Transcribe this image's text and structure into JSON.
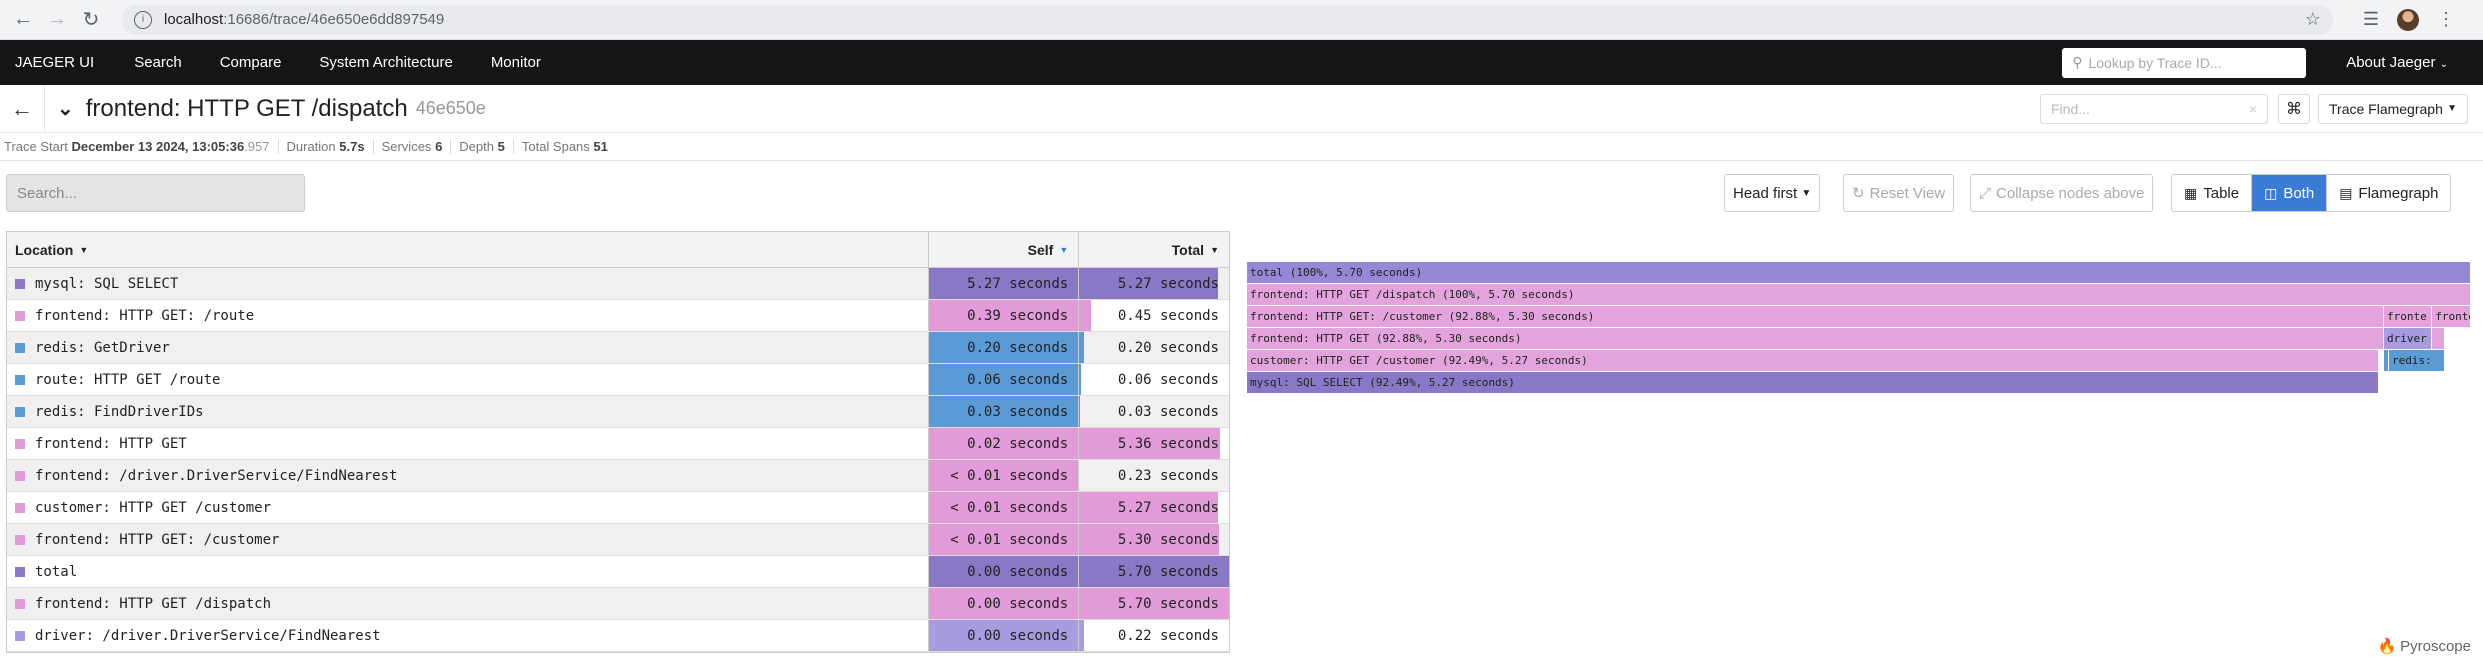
{
  "browser": {
    "url_host": "localhost",
    "url_path": ":16686/trace/46e650e6dd897549"
  },
  "nav": {
    "brand": "JAEGER UI",
    "items": [
      "Search",
      "Compare",
      "System Architecture",
      "Monitor"
    ],
    "lookup_placeholder": "Lookup by Trace ID...",
    "about": "About Jaeger"
  },
  "trace": {
    "title": "frontend: HTTP GET /dispatch",
    "id_short": "46e650e",
    "find_placeholder": "Find...",
    "view_mode": "Trace Flamegraph",
    "meta": {
      "start_label": "Trace Start",
      "start_date": "December 13 2024, 13:05:36",
      "start_ms": ".957",
      "duration_label": "Duration",
      "duration": "5.7s",
      "services_label": "Services",
      "services": "6",
      "depth_label": "Depth",
      "depth": "5",
      "spans_label": "Total Spans",
      "spans": "51"
    }
  },
  "toolbar": {
    "search_placeholder": "Search...",
    "sort": "Head first",
    "reset": "Reset View",
    "collapse": "Collapse nodes above",
    "views": [
      "Table",
      "Both",
      "Flamegraph"
    ],
    "active_view": "Both"
  },
  "table": {
    "headers": {
      "location": "Location",
      "self": "Self",
      "total": "Total"
    },
    "rows": [
      {
        "name": "mysql: SQL SELECT",
        "self": "5.27 seconds",
        "total": "5.27 seconds",
        "color": "#8a78c6",
        "self_frac": 1.0,
        "total_frac": 0.925
      },
      {
        "name": "frontend: HTTP GET: /route",
        "self": "0.39 seconds",
        "total": "0.45 seconds",
        "color": "#e19bd9",
        "self_frac": 1.0,
        "total_frac": 0.08
      },
      {
        "name": "redis: GetDriver",
        "self": "0.20 seconds",
        "total": "0.20 seconds",
        "color": "#5b9bd5",
        "self_frac": 1.0,
        "total_frac": 0.035
      },
      {
        "name": "route: HTTP GET /route",
        "self": "0.06 seconds",
        "total": "0.06 seconds",
        "color": "#5b9bd5",
        "self_frac": 1.0,
        "total_frac": 0.01
      },
      {
        "name": "redis: FindDriverIDs",
        "self": "0.03 seconds",
        "total": "0.03 seconds",
        "color": "#5b9bd5",
        "self_frac": 1.0,
        "total_frac": 0.005
      },
      {
        "name": "frontend: HTTP GET",
        "self": "0.02 seconds",
        "total": "5.36 seconds",
        "color": "#e19bd9",
        "self_frac": 1.0,
        "total_frac": 0.94
      },
      {
        "name": "frontend: /driver.DriverService/FindNearest",
        "self": "< 0.01 seconds",
        "total": "0.23 seconds",
        "color": "#e19bd9",
        "self_frac": 1.0,
        "total_frac": 0.0
      },
      {
        "name": "customer: HTTP GET /customer",
        "self": "< 0.01 seconds",
        "total": "5.27 seconds",
        "color": "#e19bd9",
        "self_frac": 1.0,
        "total_frac": 0.925
      },
      {
        "name": "frontend: HTTP GET: /customer",
        "self": "< 0.01 seconds",
        "total": "5.30 seconds",
        "color": "#e19bd9",
        "self_frac": 1.0,
        "total_frac": 0.93
      },
      {
        "name": "total",
        "self": "0.00 seconds",
        "total": "5.70 seconds",
        "color": "#8a78c6",
        "self_frac": 1.0,
        "total_frac": 1.0
      },
      {
        "name": "frontend: HTTP GET /dispatch",
        "self": "0.00 seconds",
        "total": "5.70 seconds",
        "color": "#e19bd9",
        "self_frac": 1.0,
        "total_frac": 1.0
      },
      {
        "name": "driver: /driver.DriverService/FindNearest",
        "self": "0.00 seconds",
        "total": "0.22 seconds",
        "color": "#a89be0",
        "self_frac": 1.0,
        "total_frac": 0.035
      }
    ]
  },
  "flamegraph": {
    "rows": [
      [
        {
          "label": "total (100%, 5.70 seconds)",
          "start": 0.0,
          "width": 1.0,
          "color": "#9588d4"
        }
      ],
      [
        {
          "label": "frontend: HTTP GET /dispatch (100%, 5.70 seconds)",
          "start": 0.0,
          "width": 1.0,
          "color": "#e3a3dc"
        }
      ],
      [
        {
          "label": "frontend: HTTP GET: /customer (92.88%, 5.30 seconds)",
          "start": 0.0,
          "width": 0.9289,
          "color": "#e3a3dc"
        },
        {
          "label": "fronte",
          "start": 0.9289,
          "width": 0.0395,
          "color": "#e3a3dc"
        },
        {
          "label": "fronte",
          "start": 0.9684,
          "width": 0.0316,
          "color": "#e3a3dc"
        }
      ],
      [
        {
          "label": "frontend: HTTP GET (92.88%, 5.30 seconds)",
          "start": 0.0,
          "width": 0.9289,
          "color": "#e3a3dc"
        },
        {
          "label": "driver",
          "start": 0.9289,
          "width": 0.0395,
          "color": "#a89be0"
        },
        {
          "label": "",
          "start": 0.9684,
          "width": 0.0105,
          "color": "#e3a3dc"
        }
      ],
      [
        {
          "label": "customer: HTTP GET /customer (92.49%, 5.27 seconds)",
          "start": 0.0,
          "width": 0.9249,
          "color": "#e3a3dc"
        },
        {
          "label": "",
          "start": 0.9289,
          "width": 0.0041,
          "color": "#5b9bd5"
        },
        {
          "label": "redis:",
          "start": 0.933,
          "width": 0.0356,
          "color": "#5b9bd5"
        },
        {
          "label": "",
          "start": 0.9684,
          "width": 0.0105,
          "color": "#5b9bd5"
        }
      ],
      [
        {
          "label": "mysql: SQL SELECT (92.49%, 5.27 seconds)",
          "start": 0.0,
          "width": 0.9249,
          "color": "#8a78c6"
        }
      ]
    ],
    "brand": "Pyroscope"
  }
}
